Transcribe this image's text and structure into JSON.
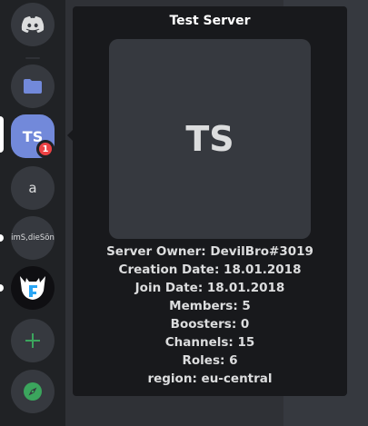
{
  "guild_rail": {
    "servers": [
      {
        "acronym": "TS",
        "mention_count": "1"
      },
      {
        "acronym": "a"
      },
      {
        "acronym": "imS,dieSön"
      }
    ]
  },
  "tooltip": {
    "server_name": "Test Server",
    "icon_acronym": "TS",
    "info": {
      "owner": "Server Owner: DevilBro#3019",
      "creation": "Creation Date: 18.01.2018",
      "join": "Join Date: 18.01.2018",
      "members": "Members: 5",
      "boosters": "Boosters: 0",
      "channels": "Channels: 15",
      "roles": "Roles: 6",
      "region": "region: eu-central"
    }
  },
  "colors": {
    "rail": "#202225",
    "accent": "#7289da",
    "green": "#3ba55d",
    "mention_red": "#ed4245",
    "tooltip_bg": "#18191c"
  },
  "icons": [
    "discord-logo-icon",
    "folder-icon",
    "ghost-bot-icon",
    "plus-icon",
    "compass-icon"
  ]
}
